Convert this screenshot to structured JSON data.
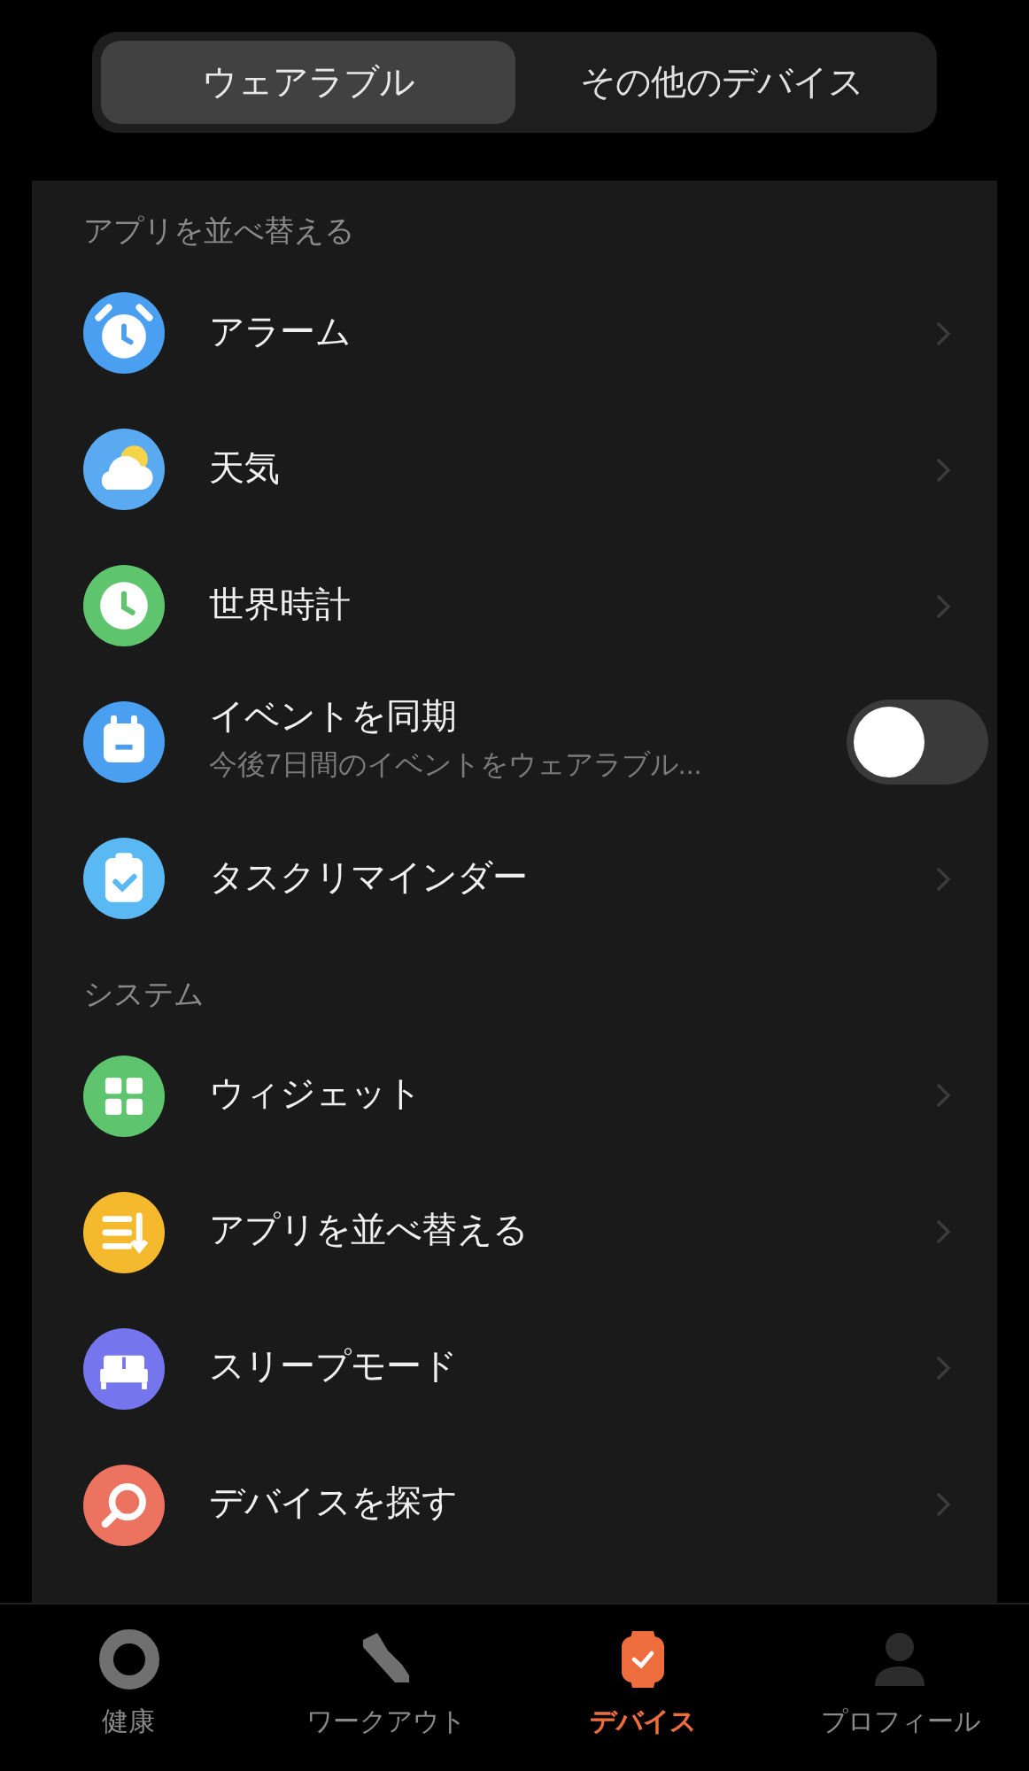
{
  "tabs": [
    {
      "label": "ウェアラブル",
      "selected": true
    },
    {
      "label": "その他のデバイス",
      "selected": false
    }
  ],
  "sections": [
    {
      "header": "アプリを並べ替える",
      "items": [
        {
          "kind": "link",
          "title": "アラーム",
          "color": "#4a9ff0"
        },
        {
          "kind": "link",
          "title": "天気",
          "color": "#5aaaf2"
        },
        {
          "kind": "link",
          "title": "世界時計",
          "color": "#5ec46e"
        },
        {
          "kind": "toggle",
          "title": "イベントを同期",
          "subtitle": "今後7日間のイベントをウェアラブル...",
          "on": false,
          "color": "#4a9ff0"
        },
        {
          "kind": "link",
          "title": "タスクリマインダー",
          "color": "#5ab8f2"
        }
      ]
    },
    {
      "header": "システム",
      "items": [
        {
          "kind": "link",
          "title": "ウィジェット",
          "color": "#5ec46e"
        },
        {
          "kind": "link",
          "title": "アプリを並べ替える",
          "color": "#f5b92e"
        },
        {
          "kind": "link",
          "title": "スリープモード",
          "color": "#7576ee"
        },
        {
          "kind": "link",
          "title": "デバイスを探す",
          "color": "#ec7360"
        }
      ]
    }
  ],
  "bottom_nav": [
    {
      "label": "健康",
      "selected": false
    },
    {
      "label": "ワークアウト",
      "selected": false
    },
    {
      "label": "デバイス",
      "selected": true
    },
    {
      "label": "プロフィール",
      "selected": false
    }
  ]
}
